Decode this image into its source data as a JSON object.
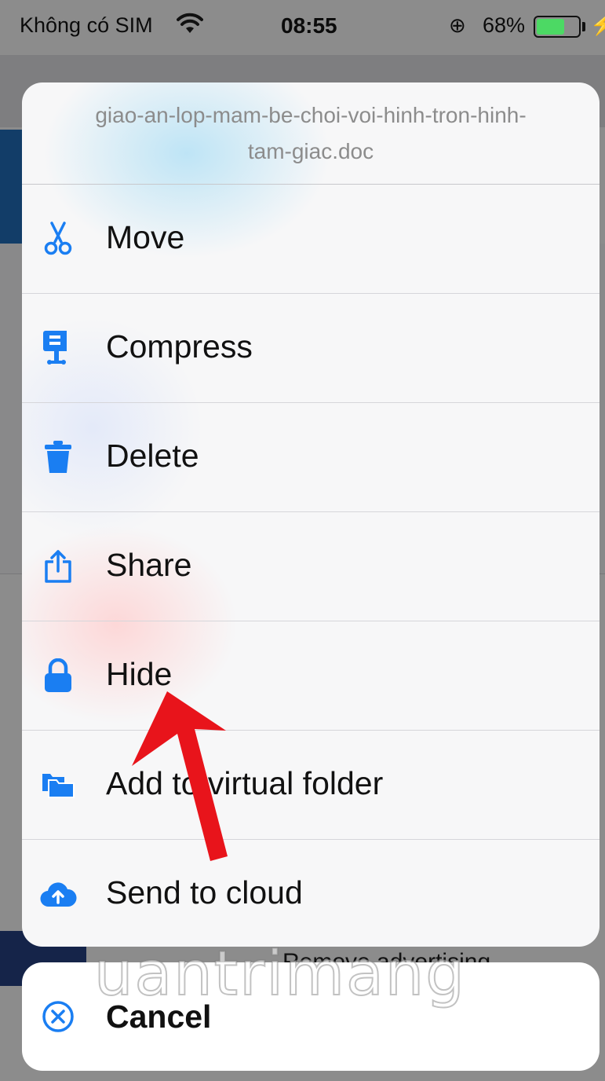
{
  "status_bar": {
    "carrier": "Không có SIM",
    "time": "08:55",
    "battery_percent": "68%",
    "battery_level": 0.68
  },
  "background": {
    "ad_text": "Remove advertising"
  },
  "action_sheet": {
    "title": "giao-an-lop-mam-be-choi-voi-hinh-tron-hinh-tam-giac.doc",
    "accent_color": "#1a7ef2",
    "items": [
      {
        "label": "Move",
        "icon": "scissors-icon"
      },
      {
        "label": "Compress",
        "icon": "compress-clamp-icon"
      },
      {
        "label": "Delete",
        "icon": "trash-icon"
      },
      {
        "label": "Share",
        "icon": "share-icon"
      },
      {
        "label": "Hide",
        "icon": "lock-icon"
      },
      {
        "label": "Add to virtual folder",
        "icon": "folders-icon"
      },
      {
        "label": "Send to cloud",
        "icon": "cloud-upload-icon"
      }
    ],
    "cancel_label": "Cancel"
  },
  "annotation": {
    "arrow_color": "#e8141b"
  },
  "watermark": {
    "text": "uantrimang"
  }
}
